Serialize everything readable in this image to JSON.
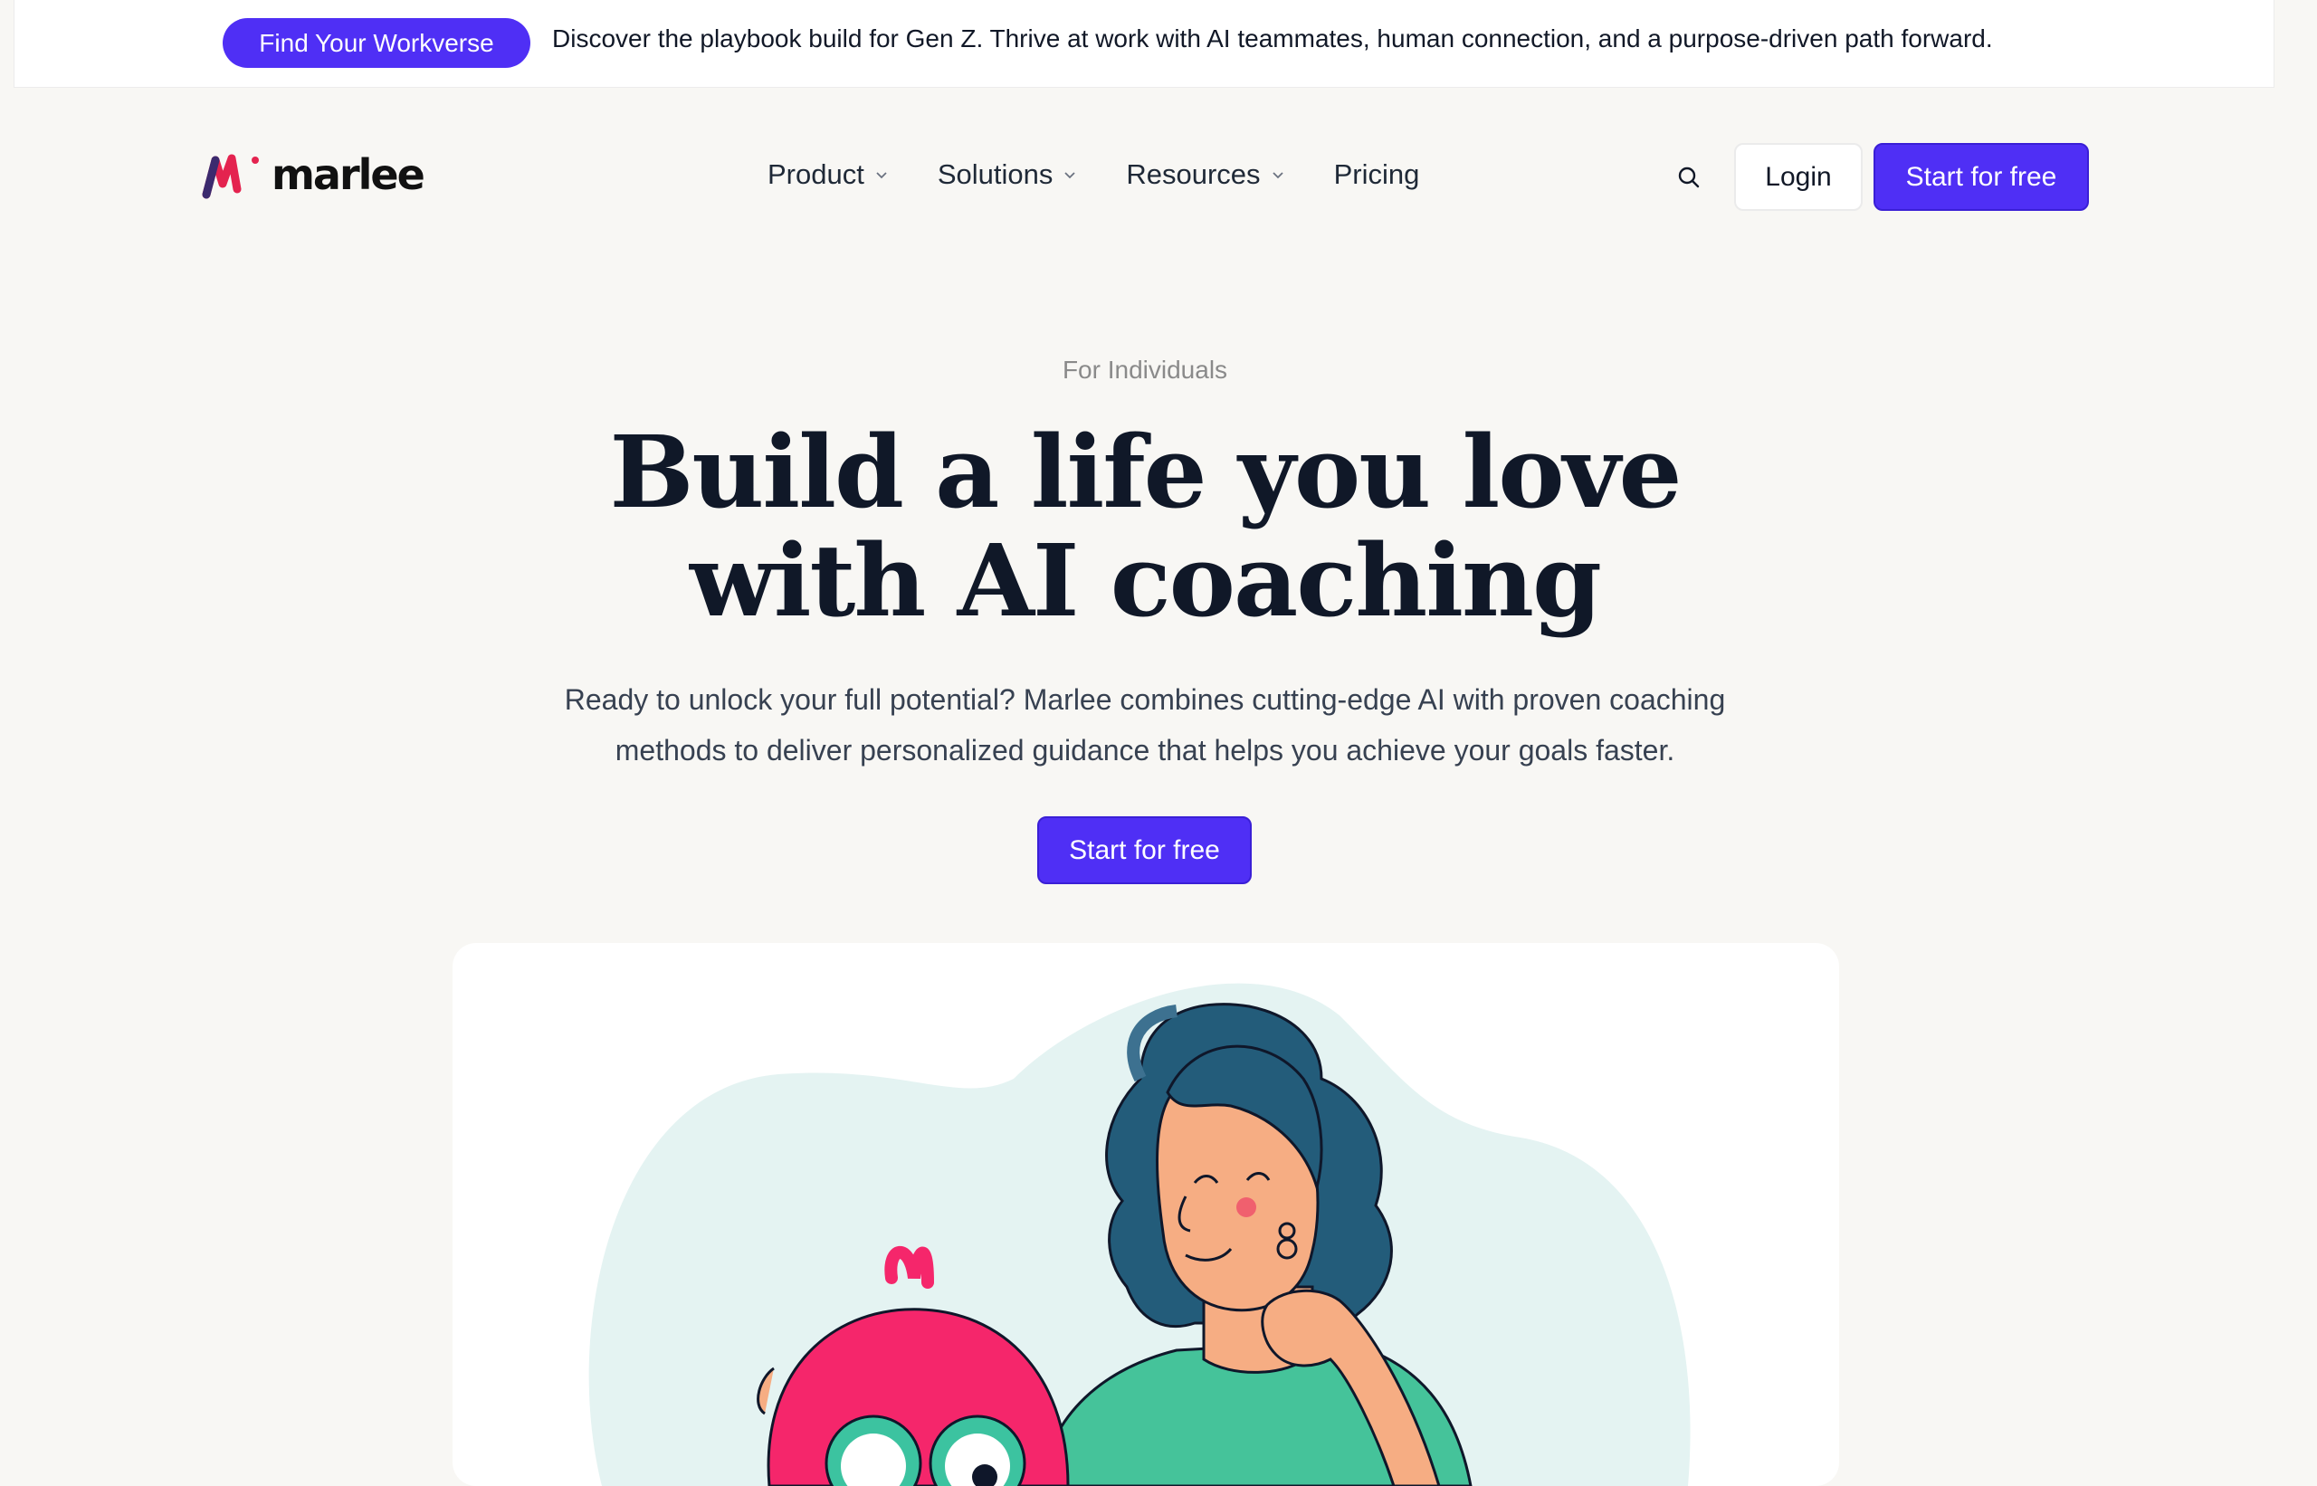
{
  "announcement": {
    "pill_label": "Find Your Workverse",
    "text": "Discover the playbook build for Gen Z. Thrive at work with AI teammates, human connection, and a purpose-driven path forward."
  },
  "header": {
    "logo_text": "marlee",
    "nav": [
      {
        "label": "Product",
        "has_dropdown": true
      },
      {
        "label": "Solutions",
        "has_dropdown": true
      },
      {
        "label": "Resources",
        "has_dropdown": true
      },
      {
        "label": "Pricing",
        "has_dropdown": false
      }
    ],
    "search_icon": "search-icon",
    "login_label": "Login",
    "cta_label": "Start for free"
  },
  "hero": {
    "eyebrow": "For Individuals",
    "headline_line1": "Build a life you love",
    "headline_line2": "with AI coaching",
    "subtext_line1": "Ready to unlock your full potential? Marlee combines cutting-edge AI with proven coaching",
    "subtext_line2": "methods to deliver personalized guidance that helps you achieve your goals faster.",
    "cta_label": "Start for free"
  },
  "colors": {
    "accent": "#4f2ff5",
    "page_bg": "#f8f7f4",
    "heading": "#101828",
    "blob": "#e4f3f2",
    "hair": "#235c7a",
    "skin": "#f6ad83",
    "shirt": "#45c39a",
    "owl": "#f5266b"
  }
}
